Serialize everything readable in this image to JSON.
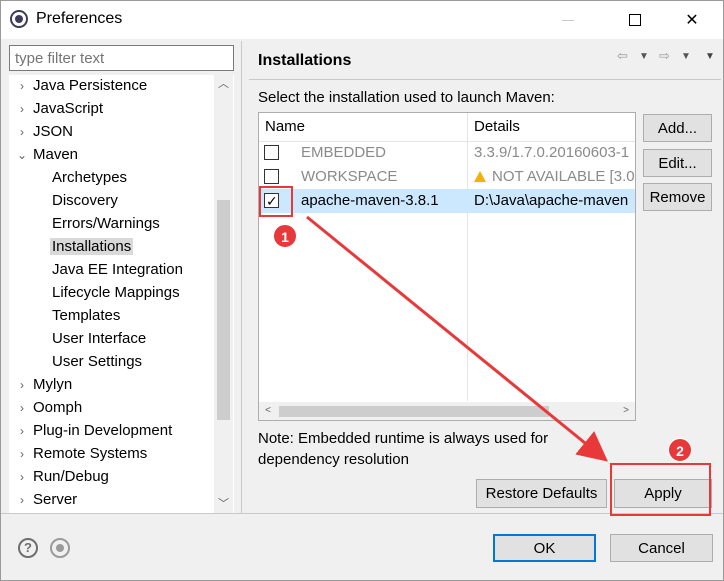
{
  "window": {
    "title": "Preferences",
    "controls": {
      "minimize": "–",
      "maximize": "□",
      "close": "✕"
    }
  },
  "filter": {
    "placeholder": "type filter text"
  },
  "tree": {
    "items": [
      {
        "label": "Java Persistence",
        "level": 0,
        "expanded": false
      },
      {
        "label": "JavaScript",
        "level": 0,
        "expanded": false
      },
      {
        "label": "JSON",
        "level": 0,
        "expanded": false
      },
      {
        "label": "Maven",
        "level": 0,
        "expanded": true
      },
      {
        "label": "Archetypes",
        "level": 1
      },
      {
        "label": "Discovery",
        "level": 1
      },
      {
        "label": "Errors/Warnings",
        "level": 1
      },
      {
        "label": "Installations",
        "level": 1,
        "selected": true
      },
      {
        "label": "Java EE Integration",
        "level": 1
      },
      {
        "label": "Lifecycle Mappings",
        "level": 1
      },
      {
        "label": "Templates",
        "level": 1
      },
      {
        "label": "User Interface",
        "level": 1
      },
      {
        "label": "User Settings",
        "level": 1
      },
      {
        "label": "Mylyn",
        "level": 0,
        "expanded": false
      },
      {
        "label": "Oomph",
        "level": 0,
        "expanded": false
      },
      {
        "label": "Plug-in Development",
        "level": 0,
        "expanded": false
      },
      {
        "label": "Remote Systems",
        "level": 0,
        "expanded": false
      },
      {
        "label": "Run/Debug",
        "level": 0,
        "expanded": false
      },
      {
        "label": "Server",
        "level": 0,
        "expanded": false
      }
    ]
  },
  "page": {
    "title": "Installations",
    "select_label": "Select the installation used to launch Maven:",
    "table": {
      "columns": [
        "Name",
        "Details"
      ],
      "rows": [
        {
          "checked": false,
          "name": "EMBEDDED",
          "details": "3.3.9/1.7.0.20160603-1",
          "muted": true
        },
        {
          "checked": false,
          "name": "WORKSPACE",
          "details": "NOT AVAILABLE [3.0",
          "muted": true,
          "warning": true
        },
        {
          "checked": true,
          "name": "apache-maven-3.8.1",
          "details": "D:\\Java\\apache-maven",
          "selected": true
        }
      ]
    },
    "side_buttons": {
      "add": "Add...",
      "edit": "Edit...",
      "remove": "Remove"
    },
    "note": "Note: Embedded runtime is always used for dependency resolution",
    "restore_defaults": "Restore Defaults",
    "apply": "Apply"
  },
  "footer": {
    "ok": "OK",
    "cancel": "Cancel"
  },
  "annotations": {
    "step1": "1",
    "step2": "2",
    "color": "#e8393a"
  }
}
